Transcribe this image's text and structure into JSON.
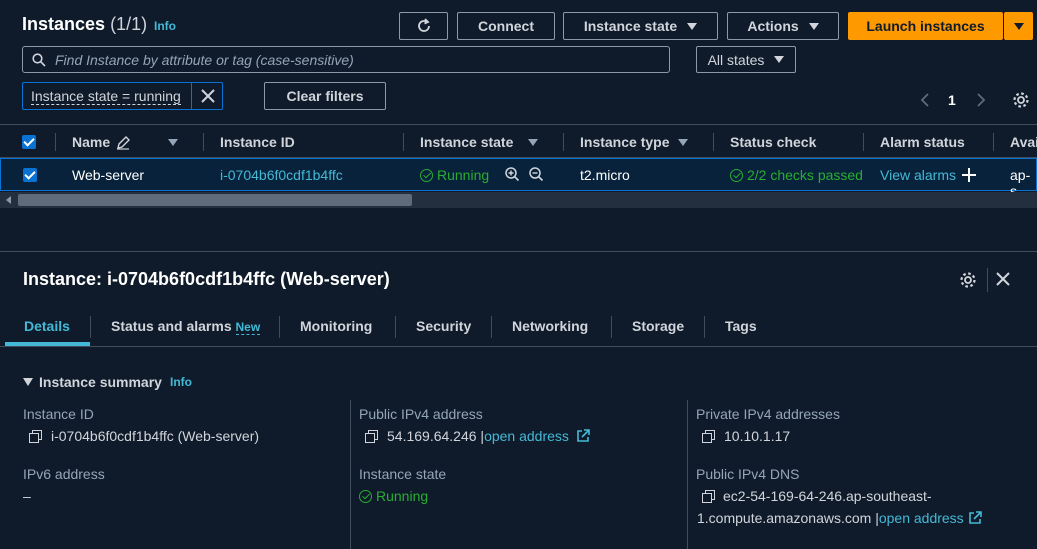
{
  "header": {
    "title": "Instances",
    "count": "(1/1)",
    "info": "Info",
    "connect": "Connect",
    "instance_state": "Instance state",
    "actions": "Actions",
    "launch": "Launch instances"
  },
  "search": {
    "placeholder": "Find Instance by attribute or tag (case-sensitive)"
  },
  "state_filter": "All states",
  "filter_token": "Instance state = running",
  "clear_filters": "Clear filters",
  "pagination": {
    "page": "1"
  },
  "table": {
    "columns": [
      "Name",
      "Instance ID",
      "Instance state",
      "Instance type",
      "Status check",
      "Alarm status",
      "Avai"
    ],
    "row": {
      "name": "Web-server",
      "instance_id": "i-0704b6f0cdf1b4ffc",
      "state": "Running",
      "type": "t2.micro",
      "status_check": "2/2 checks passed",
      "alarm": "View alarms",
      "az": "ap-s"
    }
  },
  "detail": {
    "title": "Instance: i-0704b6f0cdf1b4ffc (Web-server)",
    "tabs": [
      "Details",
      "Status and alarms",
      "Monitoring",
      "Security",
      "Networking",
      "Storage",
      "Tags"
    ],
    "new_badge": "New",
    "summary_title": "Instance summary",
    "summary_info": "Info",
    "fields": {
      "instance_id_label": "Instance ID",
      "instance_id_value": "i-0704b6f0cdf1b4ffc (Web-server)",
      "ipv6_label": "IPv6 address",
      "ipv6_value": "–",
      "public_ip_label": "Public IPv4 address",
      "public_ip_value": "54.169.64.246",
      "open_address": "open address",
      "state_label": "Instance state",
      "state_value": "Running",
      "private_ip_label": "Private IPv4 addresses",
      "private_ip_value": "10.10.1.17",
      "dns_label": "Public IPv4 DNS",
      "dns_line1": "ec2-54-169-64-246.ap-southeast-",
      "dns_line2": "1.compute.amazonaws.com"
    }
  },
  "colors": {
    "background": "#0f1b2a",
    "accent": "#ff9900",
    "link": "#44b9d6",
    "success": "#29ad32",
    "selected_row": "#07223a"
  }
}
